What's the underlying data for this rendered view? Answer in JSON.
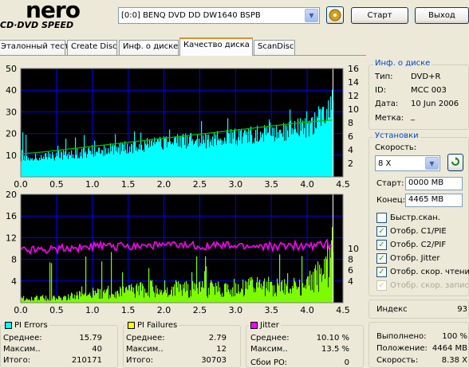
{
  "logo": {
    "brand": "nero",
    "product": "CD·DVD SPEED"
  },
  "drive": {
    "selected": "[0:0]   BENQ DVD DD DW1640 BSPB"
  },
  "buttons": {
    "start": "Старт",
    "exit": "Выход"
  },
  "tabs": [
    {
      "label": "Эталонный тест"
    },
    {
      "label": "Create Disc"
    },
    {
      "label": "Инф. о диске"
    },
    {
      "label": "Качество диска",
      "active": true
    },
    {
      "label": "ScanDisc"
    }
  ],
  "disc_info": {
    "title": "Инф. о диске",
    "type_label": "Тип:",
    "type_value": "DVD+R",
    "id_label": "ID:",
    "id_value": "MCC 003",
    "date_label": "Дата:",
    "date_value": "10 Jun 2006",
    "mark_label": "Метка:",
    "mark_value": "_"
  },
  "settings": {
    "title": "Установки",
    "speed_label": "Скорость:",
    "speed_value": "8 X",
    "start_label": "Старт:",
    "start_value": "0000 MB",
    "end_label": "Конец:",
    "end_value": "4465 MB",
    "checkboxes": [
      {
        "label": "Быстр.скан.",
        "checked": false,
        "disabled": false
      },
      {
        "label": "Отобр. C1/PIE",
        "checked": true,
        "disabled": false
      },
      {
        "label": "Отобр. C2/PIF",
        "checked": true,
        "disabled": false
      },
      {
        "label": "Отобр. Jitter",
        "checked": true,
        "disabled": false
      },
      {
        "label": "Отобр. скор. чтения",
        "checked": true,
        "disabled": false
      },
      {
        "label": "Отобр. скор. записи",
        "checked": true,
        "disabled": true
      }
    ]
  },
  "index": {
    "label": "Индекс",
    "value": "93"
  },
  "progress": {
    "done_label": "Выполнено:",
    "done_value": "100 %",
    "position_label": "Положение:",
    "position_value": "4464 MB",
    "speed_label": "Скорость:",
    "speed_value": "8.38 X"
  },
  "pi_errors": {
    "title": "PI Errors",
    "color": "#00ffff",
    "avg_label": "Среднее:",
    "avg": "15.79",
    "max_label": "Максим..",
    "max": "40",
    "total_label": "Итого:",
    "total": "210171"
  },
  "pi_failures": {
    "title": "PI Failures",
    "color": "#ffff00",
    "avg_label": "Среднее:",
    "avg": "2.79",
    "max_label": "Максим..",
    "max": "12",
    "total_label": "Итого:",
    "total": "30703"
  },
  "jitter": {
    "title": "Jitter",
    "color": "#ff00ff",
    "avg_label": "Среднее:",
    "avg": "10.10 %",
    "max_label": "Максим..",
    "max": "13.5 %",
    "po_label": "Сбои PO:",
    "po": "0"
  },
  "colors": {
    "pi_errors": "#00ffff",
    "pi_failures": "#7cfc00",
    "jitter": "#ff00ff",
    "read_speed": "#00c000",
    "grid": "#0000ff",
    "plot_bg": "#000000",
    "position_line": "#ffffff",
    "window_bg": "#ece9d8",
    "accent": "#0046d5"
  },
  "chart_data": [
    {
      "type": "area",
      "name": "PI Errors / Read speed",
      "x": [
        0,
        0.25,
        0.5,
        0.75,
        1.0,
        1.25,
        1.5,
        1.75,
        2.0,
        2.25,
        2.5,
        2.75,
        3.0,
        3.25,
        3.5,
        3.75,
        4.0,
        4.25,
        4.36
      ],
      "series": [
        {
          "axis": "left",
          "color": "#00ffff",
          "values": [
            9,
            9,
            10,
            11,
            12,
            13,
            14,
            15,
            16,
            17,
            17,
            18,
            19,
            20,
            21,
            22,
            23,
            28,
            34
          ]
        },
        {
          "axis": "right",
          "color": "#00c000",
          "values": [
            3.4,
            3.6,
            3.9,
            4.2,
            4.5,
            4.8,
            5.1,
            5.4,
            5.7,
            6.0,
            6.3,
            6.6,
            6.9,
            7.2,
            7.5,
            7.8,
            8.1,
            8.3,
            8.4
          ]
        }
      ],
      "x_ticks": [
        "0.0",
        "0.5",
        "1.0",
        "1.5",
        "2.0",
        "2.5",
        "3.0",
        "3.5",
        "4.0",
        "4.5"
      ],
      "y_ticks": [
        "50",
        "40",
        "30",
        "20",
        "10"
      ],
      "y2_ticks": [
        "16",
        "14",
        "12",
        "10",
        "8",
        "6",
        "4",
        "2"
      ],
      "xlim": [
        0,
        4.5
      ],
      "ylim": [
        0,
        50
      ],
      "y2lim": [
        0,
        16
      ],
      "grid": true
    },
    {
      "type": "bar",
      "name": "PI Failures / Jitter",
      "x": [
        0,
        0.25,
        0.5,
        0.75,
        1.0,
        1.25,
        1.5,
        1.75,
        2.0,
        2.25,
        2.5,
        2.75,
        3.0,
        3.25,
        3.5,
        3.75,
        4.0,
        4.25,
        4.36
      ],
      "series": [
        {
          "axis": "left",
          "color": "#7cfc00",
          "values": [
            1,
            1,
            1,
            1.5,
            2,
            2,
            2.5,
            3,
            3,
            3,
            3,
            3,
            3.5,
            3.5,
            3.5,
            4,
            4,
            7,
            12
          ]
        },
        {
          "axis": "right",
          "color": "#ff00ff",
          "values": [
            9.8,
            9.9,
            10.0,
            10.2,
            10.3,
            10.4,
            10.5,
            10.6,
            10.6,
            10.5,
            10.5,
            10.5,
            10.4,
            10.4,
            10.4,
            10.5,
            10.6,
            10.8,
            10.8
          ]
        }
      ],
      "x_ticks": [
        "0.0",
        "0.5",
        "1.0",
        "1.5",
        "2.0",
        "2.5",
        "3.0",
        "3.5",
        "4.0",
        "4.5"
      ],
      "y_ticks": [
        "20",
        "16",
        "12",
        "8",
        "4"
      ],
      "y2_ticks": [
        "10",
        "8",
        "6",
        "4"
      ],
      "xlim": [
        0,
        4.5
      ],
      "ylim": [
        0,
        20
      ],
      "y2lim": [
        0,
        20
      ],
      "grid": true
    }
  ]
}
